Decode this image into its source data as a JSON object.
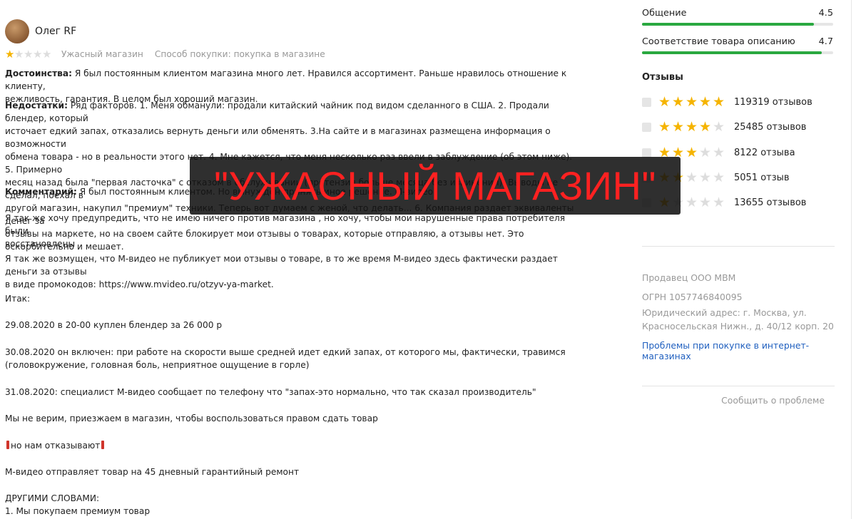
{
  "review": {
    "author": "Олег RF",
    "rating": 1,
    "verdict": "Ужасный магазин",
    "purchase": "Способ покупки: покупка в магазине",
    "pros_label": "Достоинства:",
    "pros_line1": " Я был постоянным клиентом магазина много лет. Нравился ассортимент. Раньше нравилось отношение к клиенту,",
    "pros_line2": "вежливость, гарантия. В целом был хороший магазин.",
    "cons_label": "Недостатки:",
    "cons_line1": " Ряд факторов. 1. Меня обманули: продали китайский чайник под видом сделанного в США. 2. Продали блендер, который",
    "cons_line2": "источает едкий запах, отказались вернуть деньги или обменять. 3.На сайте и в магазинах размещена информация о возможности",
    "cons_line3": "обмена товара - но в реальности этого нет. 4. Мне кажется, что меня несколько раз ввели в заблуждение (об этом ниже). 5. Примерно",
    "cons_line4": "месяц назад была \"первая ласточка\" с отказом в обслуживании (претензия больше месяца без извинений). Выводы не сделал, поехал в",
    "cons_line5": "другой магазин, накупил \"премиум\" техники. Теперь вот думаем с женой, что делать... 6. Компания раздает эквиваленты денег за",
    "cons_line6": "отзывы на маркете, но на своем сайте блокирует мои отзывы о товарах, которые отправляю, а отзывы нет. Это оскорбительно и мешает.",
    "comment_label": "Комментарий:",
    "comment_text": " Я был постоянным клиентом. Но вынужден принять иное решение. М-видео",
    "p1_line1": "Я так же хочу предупредить, что не имею ничего против магазина , но хочу, чтобы мои нарушенные права потребителя были",
    "p1_line2": "восстановлены",
    "p2_line1": "Я так же возмущен, что М-видео не публикует мои отзывы о товаре, в то же время М-видео здесь фактически раздает деньги за отзывы",
    "p2_line2": "в виде промокодов: https://www.mvideo.ru/otzyv-ya-market.",
    "p3": "Итак:",
    "p4": "29.08.2020 в 20-00 куплен блендер за 26 000 р",
    "p5_line1": "30.08.2020 он включен: при работе на скорости выше средней идет едкий запах, от которого мы, фактически, травимся",
    "p5_line2": "(головокружение, головная боль, неприятное ощущение в горле)",
    "p6": "31.08.2020: специалист М-видео сообщает по телефону что \"запах-это нормально, что так сказал производитель\"",
    "p7": "Мы не верим, приезжаем в магазин, чтобы воспользоваться правом сдать товар",
    "p8": "но нам отказывают",
    "p9": "М-видео отправляет товар на 45 дневный гарантийный ремонт",
    "p10": "ДРУГИМИ СЛОВАМИ:",
    "p11": "1. Мы покупаем премиум товар"
  },
  "banner": "\"УЖАСНЫЙ МАГАЗИН\"",
  "sidebar": {
    "criteria": [
      {
        "label": "Общение",
        "value": "4.5",
        "score": 4.5
      },
      {
        "label": "Соответствие товара описанию",
        "value": "4.7",
        "score": 4.7
      }
    ],
    "reviews_title": "Отзывы",
    "rating_rows": [
      {
        "stars": 5,
        "count": "119319 отзывов"
      },
      {
        "stars": 4,
        "count": "25485 отзывов"
      },
      {
        "stars": 3,
        "count": "8122 отзыва"
      },
      {
        "stars": 2,
        "count": "5051 отзыв"
      },
      {
        "stars": 1,
        "count": "13655 отзывов"
      }
    ],
    "seller": "Продавец ООО МВМ",
    "ogrn": "ОГРН 1057746840095",
    "address_line1": "Юридический адрес: г. Москва, ул.",
    "address_line2": "Красносельская Нижн., д. 40/12 корп. 20",
    "problems_link": "Проблемы при покупке в интернет-магазинах",
    "report": "Сообщить о проблеме"
  },
  "colors": {
    "star": "#f5b400",
    "bar": "#2aa840",
    "link": "#1f5fbf",
    "banner_text": "#ff2121"
  }
}
